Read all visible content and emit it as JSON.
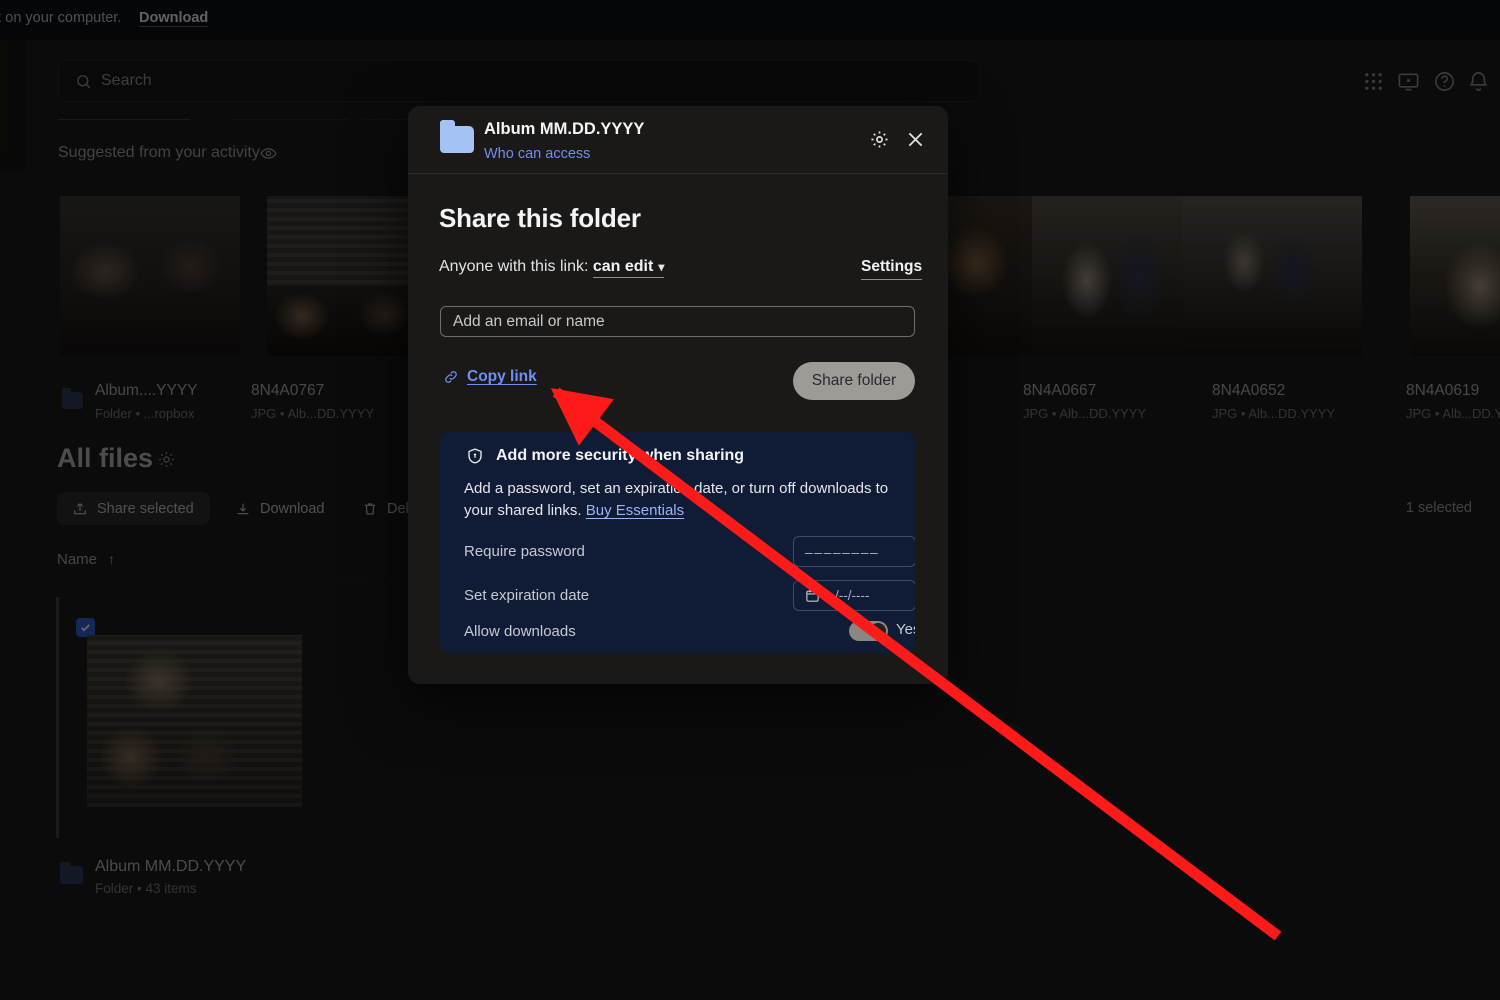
{
  "app": {
    "banner_text": "x on your computer.",
    "banner_action": "Download",
    "search_placeholder": "Search",
    "top_icons": [
      "grid-apps-icon",
      "screen-icon",
      "help-icon",
      "bell-icon"
    ],
    "suggested_label": "Suggested from your activity",
    "suggested_eye_icon": "eye-icon",
    "all_files_title": "All files",
    "all_files_gear_icon": "gear-icon",
    "selected_count": "1 selected",
    "name_column": "Name",
    "name_sort_arrow": "↑"
  },
  "toolbar": {
    "share_selected": "Share selected",
    "download": "Download",
    "delete": "Delete"
  },
  "suggested_items": [
    {
      "name": "Album....YYYY",
      "sub": "Folder • ...ropbox",
      "is_folder": true
    },
    {
      "name": "8N4A0767",
      "sub": "JPG • Alb...DD.YYYY",
      "is_folder": false
    },
    {
      "name": "8N4A0667",
      "sub": "JPG • Alb...DD.YYYY",
      "is_folder": false
    },
    {
      "name": "8N4A0652",
      "sub": "JPG • Alb...DD.YYYY",
      "is_folder": false
    },
    {
      "name": "8N4A0619",
      "sub": "JPG • Alb...DD.Y",
      "is_folder": false
    }
  ],
  "file_row": {
    "name": "Album MM.DD.YYYY",
    "sub": "Folder • 43 items",
    "checked": true
  },
  "modal": {
    "folder_icon": "folder-icon",
    "title": "Album MM.DD.YYYY",
    "who_can_access": "Who can access",
    "gear_icon": "gear-icon",
    "close_icon": "close-icon",
    "heading": "Share this folder",
    "link_label": "Anyone with this link:",
    "link_permission": "can edit",
    "link_chevron": "chevron-down-icon",
    "settings_label": "Settings",
    "email_placeholder": "Add an email or name",
    "copy_link_icon": "link-icon",
    "copy_link_label": "Copy link",
    "share_folder_label": "Share folder",
    "security": {
      "shield_icon": "shield-icon",
      "title": "Add more security when sharing",
      "description": "Add a password, set an expiration date, or turn off downloads to your shared links. ",
      "cta": "Buy Essentials",
      "rows": [
        {
          "label": "Require password",
          "value": "––––––––",
          "type": "password"
        },
        {
          "label": "Set expiration date",
          "value": "--/--/----",
          "type": "date",
          "icon": "calendar-icon"
        },
        {
          "label": "Allow downloads",
          "value": "Yes",
          "type": "toggle",
          "on": true
        }
      ]
    }
  },
  "annotation": {
    "arrow_color": "#ff1a1a",
    "points_to": "copy-link-button"
  },
  "colors": {
    "accent_blue": "#6d90f2",
    "security_panel_bg": "#101b35",
    "modal_bg": "#1a1918",
    "page_bg": "#0b0b0c",
    "arrow_red": "#ff1a1a"
  }
}
